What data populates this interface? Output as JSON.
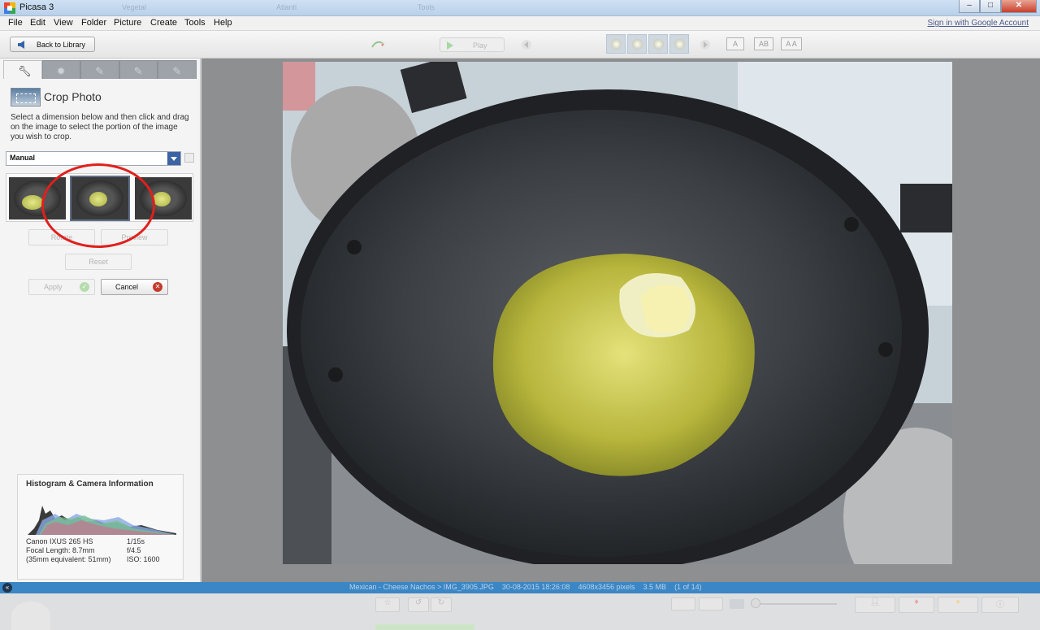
{
  "window": {
    "title": "Picasa 3",
    "ghost_tabs": [
      "Vegetal",
      "Atlanti",
      "Tools"
    ],
    "buttons": [
      "minimize",
      "maximize",
      "close"
    ]
  },
  "menu": {
    "items": [
      "File",
      "Edit",
      "View",
      "Folder",
      "Picture",
      "Create",
      "Tools",
      "Help"
    ],
    "signin": "Sign in with Google Account"
  },
  "toolbar": {
    "back_label": "Back to Library",
    "play_label": "Play",
    "text_buttons": [
      "A",
      "AB",
      "A A"
    ]
  },
  "left_panel": {
    "tabs": [
      "basic-fixes",
      "tuning",
      "effects",
      "effects-2",
      "effects-3"
    ],
    "crop_title": "Crop Photo",
    "crop_help": "Select a dimension below and then click and drag on the image to select the portion of the image you wish to crop.",
    "dimension_value": "Manual",
    "buttons": {
      "rotate": "Rotate",
      "preview": "Preview",
      "reset": "Reset",
      "apply": "Apply",
      "cancel": "Cancel"
    },
    "histogram": {
      "title": "Histogram & Camera Information",
      "camera": "Canon IXUS 265 HS",
      "focal": "Focal Length: 8.7mm",
      "equiv": "(35mm equivalent:  51mm)",
      "shutter": "1/15s",
      "aperture": "f/4.5",
      "iso": "ISO: 1600"
    }
  },
  "status": {
    "path": "Mexican - Cheese Nachos > IMG_3905.JPG",
    "datetime": "30-08-2015 18:26:08",
    "dims": "4608x3456 pixels",
    "size": "3.5 MB",
    "count": "(1 of 14)"
  },
  "colors": {
    "accent": "#3b86c4",
    "highlight_ring": "#e0201c",
    "cancel_icon": "#c53a2b"
  }
}
